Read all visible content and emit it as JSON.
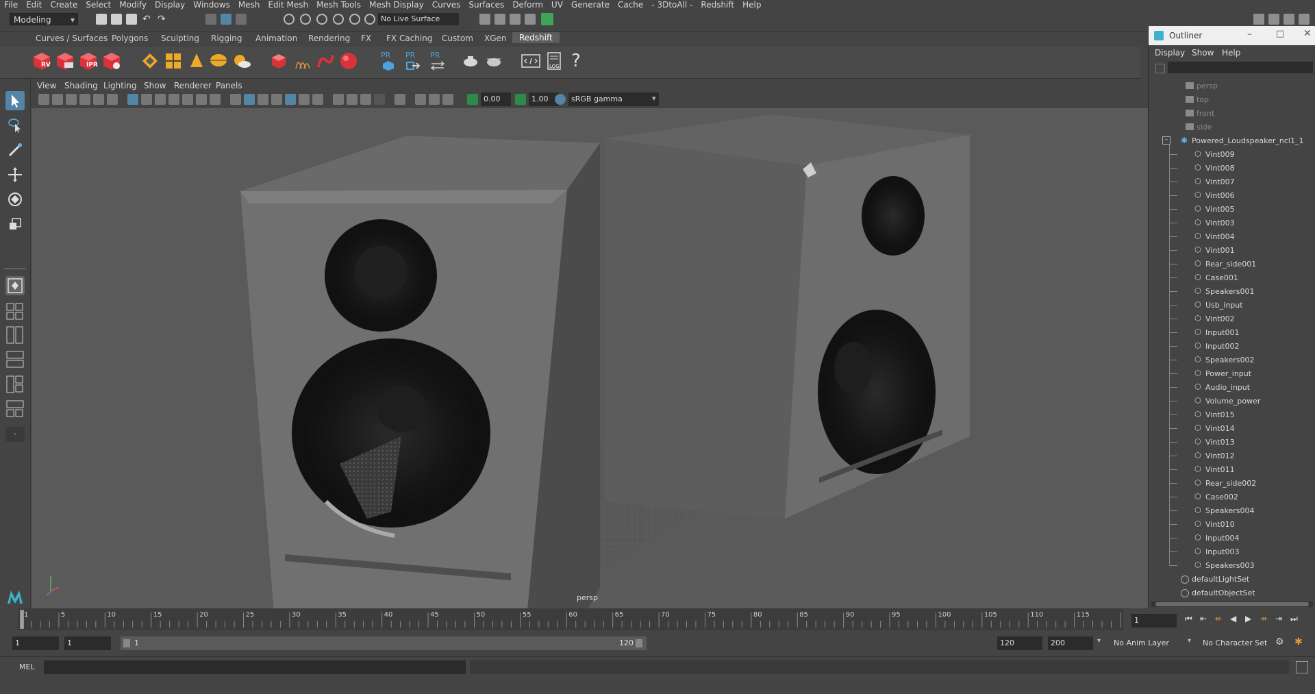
{
  "menubar": [
    "File",
    "Edit",
    "Create",
    "Select",
    "Modify",
    "Display",
    "Windows",
    "Mesh",
    "Edit Mesh",
    "Mesh Tools",
    "Mesh Display",
    "Curves",
    "Surfaces",
    "Deform",
    "UV",
    "Generate",
    "Cache",
    "- 3DtoAll -",
    "Redshift",
    "Help"
  ],
  "status": {
    "mode": "Modeling",
    "live_surface": "No Live Surface"
  },
  "shelf_tabs": [
    "Curves / Surfaces",
    "Polygons",
    "Sculpting",
    "Rigging",
    "Animation",
    "Rendering",
    "FX",
    "FX Caching",
    "Custom",
    "XGen",
    "Redshift"
  ],
  "shelf_active": "Redshift",
  "shelf_labels": {
    "rv": "RV",
    "ipr": "IPR",
    "pr1": "PR",
    "pr2": "PR",
    "pr3": "PR",
    "log": "LOG",
    "help": "?"
  },
  "viewport": {
    "menu": [
      "View",
      "Shading",
      "Lighting",
      "Show",
      "Renderer",
      "Panels"
    ],
    "exposure": "0.00",
    "gamma": "1.00",
    "color_space": "sRGB gamma",
    "camera_label": "persp"
  },
  "outliner": {
    "title": "Outliner",
    "menu": [
      "Display",
      "Show",
      "Help"
    ],
    "cameras": [
      "persp",
      "top",
      "front",
      "side"
    ],
    "group": "Powered_Loudspeaker_ncl1_1",
    "children": [
      "Vint009",
      "Vint008",
      "Vint007",
      "Vint006",
      "Vint005",
      "Vint003",
      "Vint004",
      "Vint001",
      "Rear_side001",
      "Case001",
      "Speakers001",
      "Usb_input",
      "Vint002",
      "Input001",
      "Input002",
      "Speakers002",
      "Power_input",
      "Audio_input",
      "Volume_power",
      "Vint015",
      "Vint014",
      "Vint013",
      "Vint012",
      "Vint011",
      "Rear_side002",
      "Case002",
      "Speakers004",
      "Vint010",
      "Input004",
      "Input003",
      "Speakers003"
    ],
    "sets": [
      "defaultLightSet",
      "defaultObjectSet"
    ]
  },
  "timeline": {
    "ticks": [
      "1",
      "5",
      "10",
      "15",
      "20",
      "25",
      "30",
      "35",
      "40",
      "45",
      "50",
      "55",
      "60",
      "65",
      "70",
      "75",
      "80",
      "85",
      "90",
      "95",
      "100",
      "105",
      "110",
      "115",
      "120"
    ],
    "current_frame": "1"
  },
  "range": {
    "start": "1",
    "playback_start": "1",
    "slider_start": "1",
    "slider_end": "120",
    "playback_end": "120",
    "end": "200",
    "anim_layer": "No Anim Layer",
    "char_set": "No Character Set"
  },
  "cmdline": {
    "lang": "MEL"
  },
  "colors": {
    "accent": "#5285a6",
    "redshift_red": "#d9323a",
    "viewport_bg": "#5a5a5a",
    "panel": "#444444"
  }
}
